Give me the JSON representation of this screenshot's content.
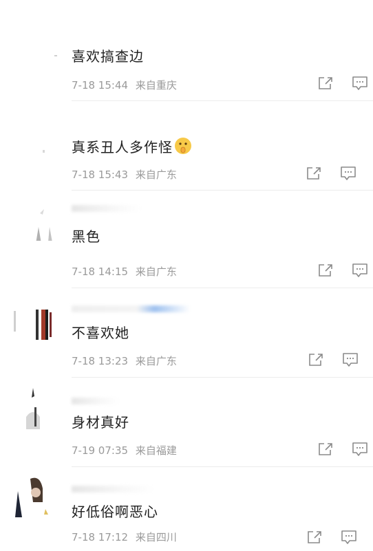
{
  "comments": [
    {
      "text": "喜欢搞查边",
      "time": "7-18 15:44",
      "source": "来自重庆"
    },
    {
      "text": "真系丑人多作怪",
      "time": "7-18 15:43",
      "source": "来自广东"
    },
    {
      "text": "黑色",
      "time": "7-18 14:15",
      "source": "来自广东"
    },
    {
      "text": "不喜欢她",
      "time": "7-18 13:23",
      "source": "来自广东"
    },
    {
      "text": "身材真好",
      "time": "7-19 07:35",
      "source": "来自福建"
    },
    {
      "text": "好低俗啊恶心",
      "time": "7-18 17:12",
      "source": "来自四川"
    }
  ],
  "icons": {
    "share": "share-icon",
    "reply": "comment-icon",
    "emoji": "shushing-face-emoji"
  },
  "colors": {
    "text": "#1f1f1f",
    "meta": "#9a9a9a",
    "icon": "#8a8a8a",
    "divider": "#ececec"
  }
}
